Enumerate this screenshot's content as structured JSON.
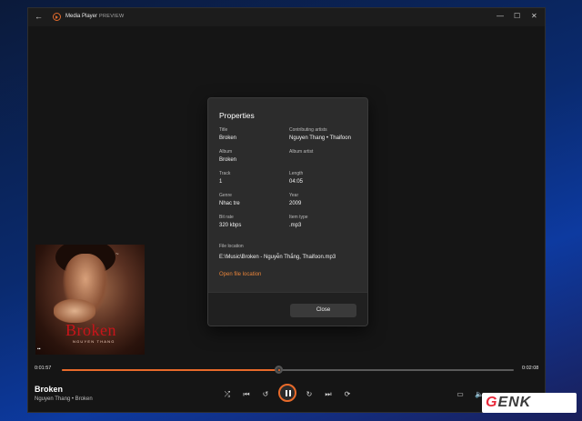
{
  "titlebar": {
    "app_name": "Media Player",
    "preview": "PREVIEW",
    "back_icon": "←",
    "minimize_icon": "—",
    "maximize_icon": "☐",
    "close_icon": "✕"
  },
  "album_art": {
    "title": "Broken",
    "artist": "NGUYEN THANG"
  },
  "player": {
    "elapsed": "0:01:57",
    "total": "0:02:08",
    "progress": 0.48,
    "song": "Broken",
    "artist_album": "Nguyen Thang • Broken",
    "accent_color": "#e86a2a"
  },
  "properties": {
    "title": "Properties",
    "fields": [
      {
        "label": "Title",
        "value": "Broken"
      },
      {
        "label": "Contributing artists",
        "value": "Nguyen Thang • Thaifoon"
      },
      {
        "label": "Album",
        "value": "Broken"
      },
      {
        "label": "Album artist",
        "value": ""
      },
      {
        "label": "Track",
        "value": "1"
      },
      {
        "label": "Length",
        "value": "04:05"
      },
      {
        "label": "Genre",
        "value": "Nhac tre"
      },
      {
        "label": "Year",
        "value": "2009"
      },
      {
        "label": "Bit rate",
        "value": "320 kbps"
      },
      {
        "label": "Item type",
        "value": ".mp3"
      }
    ],
    "file_location_label": "File location",
    "file_location": "E:\\Music\\Broken - Nguyễn Thắng, Thaifoon.mp3",
    "open_location": "Open file location",
    "close_label": "Close"
  },
  "watermark": {
    "g": "G",
    "rest": "ENK"
  }
}
